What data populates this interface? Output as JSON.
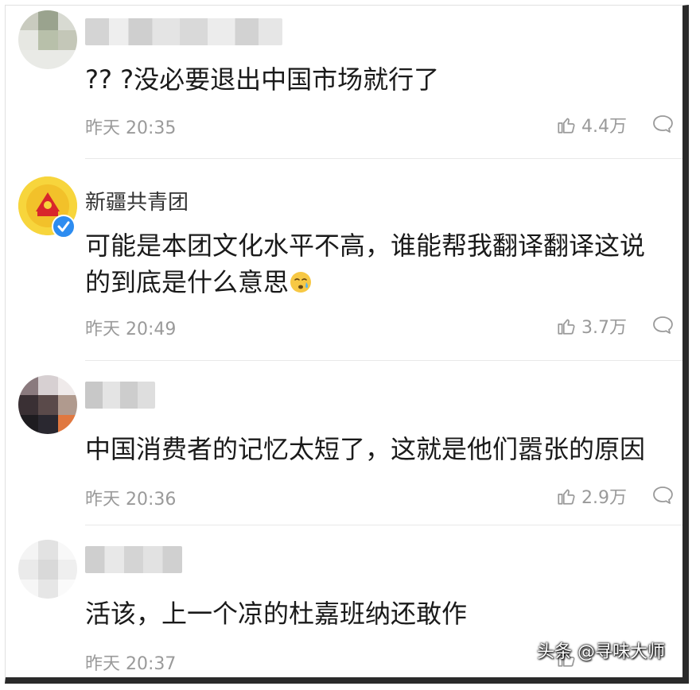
{
  "comments": [
    {
      "author": "",
      "text": "?? ?没必要退出中国市场就行了",
      "time": "昨天 20:35",
      "likes": "4.4万",
      "author_blurred": true
    },
    {
      "author": "新疆共青团",
      "text_line1": "可能是本团文化水平不高，谁能帮我翻译翻译这说",
      "text_line2": "的到底是什么意思",
      "time": "昨天 20:49",
      "likes": "3.7万",
      "verified": true
    },
    {
      "author": "",
      "text": "中国消费者的记忆太短了，这就是他们嚣张的原因",
      "time": "昨天 20:36",
      "likes": "2.9万",
      "author_blurred": true
    },
    {
      "author": "",
      "text": "活该，上一个凉的杜嘉班纳还敢作",
      "time": "昨天 20:37",
      "likes": "",
      "author_blurred": true
    }
  ],
  "icons": {
    "like": "thumbs-up-icon",
    "reply": "comment-bubble-icon",
    "emoji": "crying-face-emoji"
  },
  "watermark": "头条 @寻味大师",
  "colors": {
    "text": "#1a1a1a",
    "meta": "#9a9a9a",
    "verified": "#2d8cf0",
    "divider": "#e8e8e8"
  }
}
